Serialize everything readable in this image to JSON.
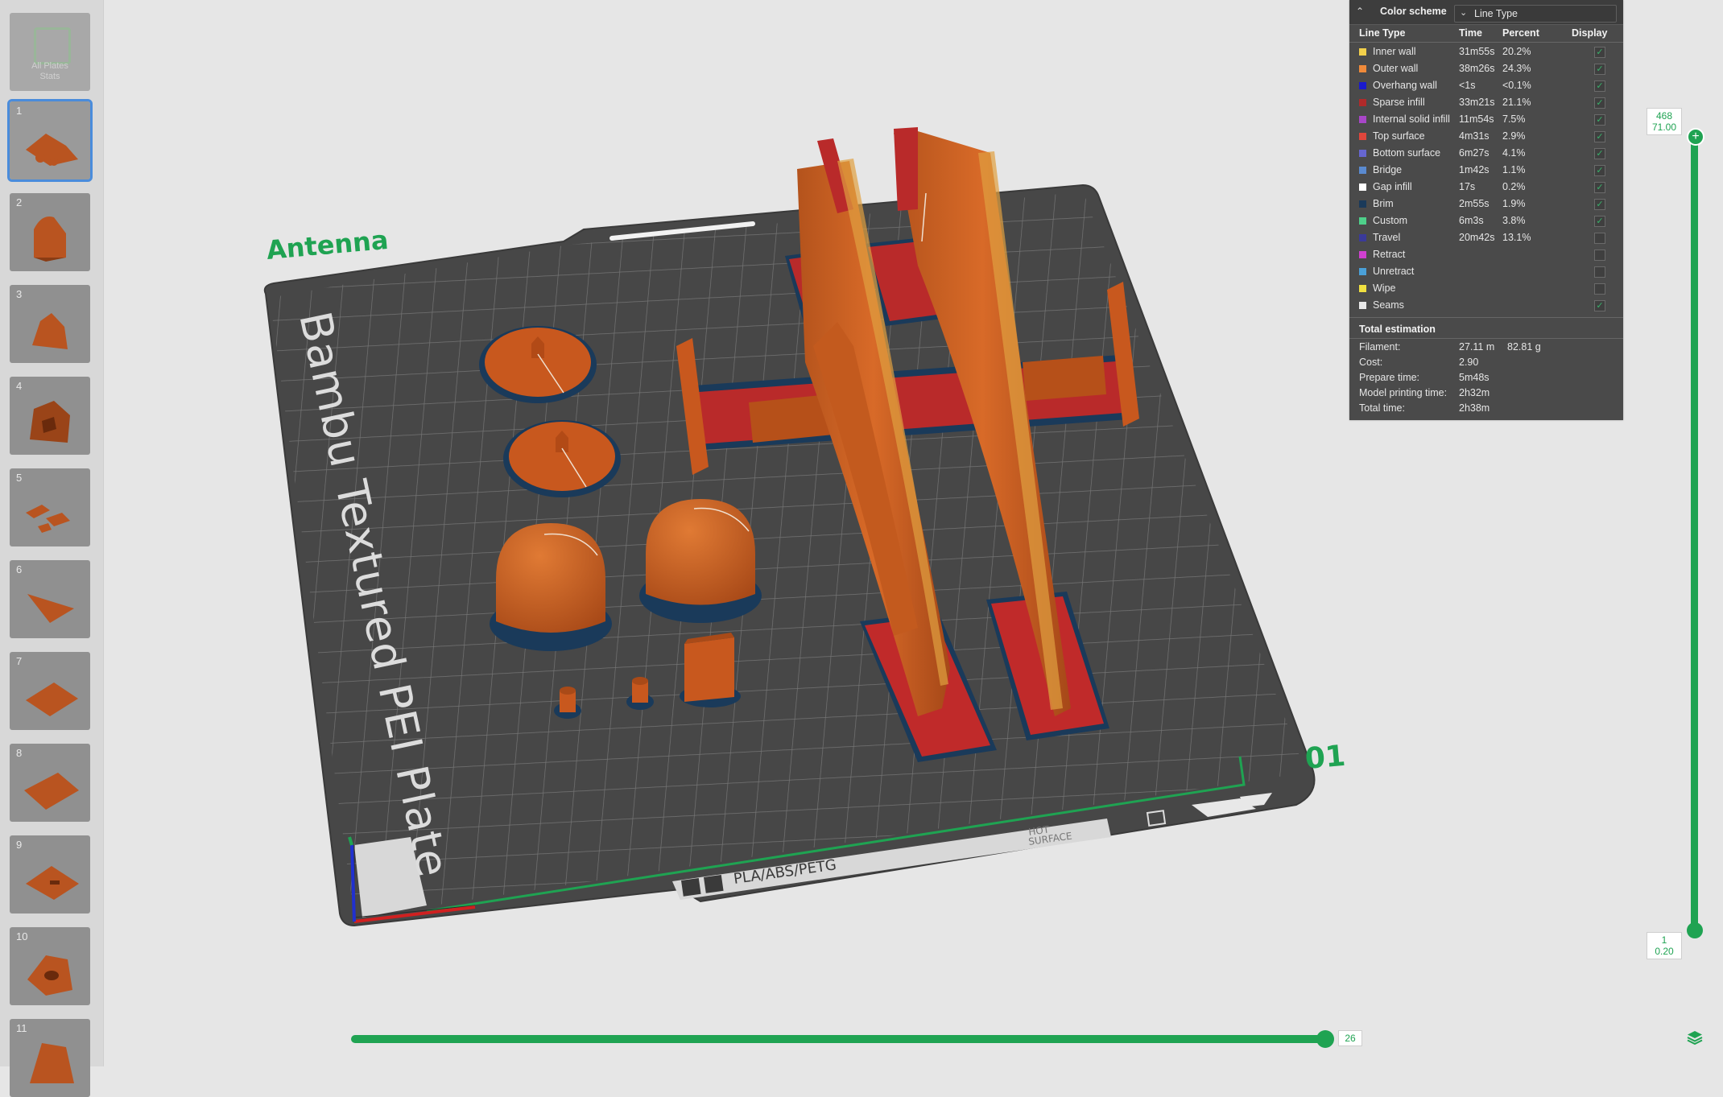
{
  "sidebar": {
    "all_plates_label_1": "All Plates",
    "all_plates_label_2": "Stats",
    "plates": [
      {
        "num": "1"
      },
      {
        "num": "2"
      },
      {
        "num": "3"
      },
      {
        "num": "4"
      },
      {
        "num": "5"
      },
      {
        "num": "6"
      },
      {
        "num": "7"
      },
      {
        "num": "8"
      },
      {
        "num": "9"
      },
      {
        "num": "10"
      },
      {
        "num": "11"
      }
    ],
    "selected_plate": "1"
  },
  "viewport": {
    "plate_name": "Antenna",
    "plate_number": "01",
    "bed_text": "Bambu Textured PEI Plate",
    "bed_label": "PLA/ABS/PETG",
    "hot_surface_1": "HOT",
    "hot_surface_2": "SURFACE"
  },
  "legend": {
    "title": "Color scheme",
    "scheme_value": "Line Type",
    "headers": {
      "type": "Line Type",
      "time": "Time",
      "percent": "Percent",
      "display": "Display"
    },
    "rows": [
      {
        "name": "Inner wall",
        "time": "31m55s",
        "percent": "20.2%",
        "color": "#f2d04b",
        "checked": true
      },
      {
        "name": "Outer wall",
        "time": "38m26s",
        "percent": "24.3%",
        "color": "#f08a3a",
        "checked": true
      },
      {
        "name": "Overhang wall",
        "time": "<1s",
        "percent": "<0.1%",
        "color": "#1a1acc",
        "checked": true
      },
      {
        "name": "Sparse infill",
        "time": "33m21s",
        "percent": "21.1%",
        "color": "#b02a2a",
        "checked": true
      },
      {
        "name": "Internal solid infill",
        "time": "11m54s",
        "percent": "7.5%",
        "color": "#a846c8",
        "checked": true
      },
      {
        "name": "Top surface",
        "time": "4m31s",
        "percent": "2.9%",
        "color": "#e0463c",
        "checked": true
      },
      {
        "name": "Bottom surface",
        "time": "6m27s",
        "percent": "4.1%",
        "color": "#6666d0",
        "checked": true
      },
      {
        "name": "Bridge",
        "time": "1m42s",
        "percent": "1.1%",
        "color": "#5a8ad0",
        "checked": true
      },
      {
        "name": "Gap infill",
        "time": "17s",
        "percent": "0.2%",
        "color": "#ffffff",
        "checked": true
      },
      {
        "name": "Brim",
        "time": "2m55s",
        "percent": "1.9%",
        "color": "#1a3a5a",
        "checked": true
      },
      {
        "name": "Custom",
        "time": "6m3s",
        "percent": "3.8%",
        "color": "#4ed08a",
        "checked": true
      },
      {
        "name": "Travel",
        "time": "20m42s",
        "percent": "13.1%",
        "color": "#3a3a9a",
        "checked": false
      },
      {
        "name": "Retract",
        "time": "",
        "percent": "",
        "color": "#d040d0",
        "checked": false
      },
      {
        "name": "Unretract",
        "time": "",
        "percent": "",
        "color": "#4aa0d8",
        "checked": false
      },
      {
        "name": "Wipe",
        "time": "",
        "percent": "",
        "color": "#f0e040",
        "checked": false
      },
      {
        "name": "Seams",
        "time": "",
        "percent": "",
        "color": "#e8e8e8",
        "checked": true
      }
    ],
    "total_title": "Total estimation",
    "totals": [
      {
        "key": "Filament:",
        "value": "27.11 m",
        "value2": "82.81 g"
      },
      {
        "key": "Cost:",
        "value": "2.90",
        "value2": ""
      },
      {
        "key": "Prepare time:",
        "value": "5m48s",
        "value2": ""
      },
      {
        "key": "Model printing time:",
        "value": "2h32m",
        "value2": ""
      },
      {
        "key": "Total time:",
        "value": "2h38m",
        "value2": ""
      }
    ]
  },
  "layer_slider": {
    "top_layer": "468",
    "top_height": "71.00",
    "bottom_layer": "1",
    "bottom_height": "0.20"
  },
  "move_slider": {
    "value": "26"
  },
  "colors": {
    "accent": "#1fa352",
    "filament": "#c8581e",
    "bed": "#474747"
  }
}
